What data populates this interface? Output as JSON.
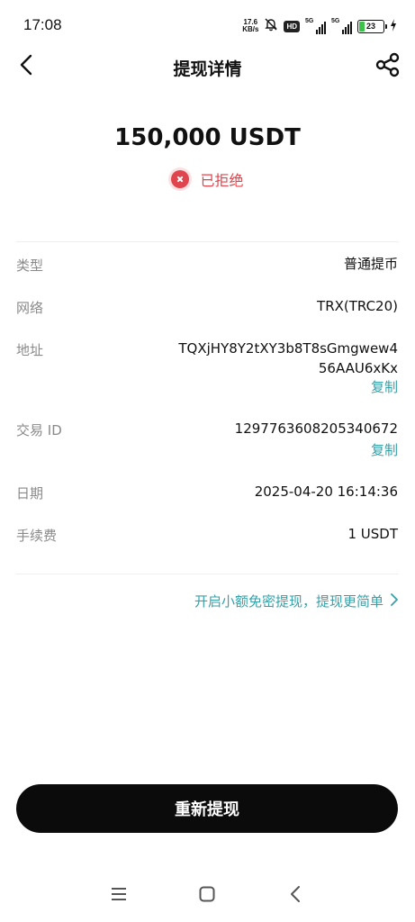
{
  "status_bar": {
    "time": "17:08",
    "net_speed_value": "17.6",
    "net_speed_unit": "KB/s",
    "hd_label": "HD",
    "signal1_label": "5G",
    "signal2_label": "5G",
    "battery_level": "23",
    "battery_fraction": 0.23
  },
  "header": {
    "title": "提现详情",
    "back_icon": "chevron-left-icon",
    "share_icon": "share-icon"
  },
  "summary": {
    "amount": "150,000 USDT",
    "status": "已拒绝",
    "status_color": "#e0454e"
  },
  "details": {
    "type": {
      "label": "类型",
      "value": "普通提币"
    },
    "network": {
      "label": "网络",
      "value": "TRX(TRC20)"
    },
    "address": {
      "label": "地址",
      "line1": "TQXjHY8Y2tXY3b8T8sGmgwew4",
      "line2": "56AAU6xKx",
      "copy_label": "复制"
    },
    "tx_id": {
      "label": "交易 ID",
      "value": "1297763608205340672",
      "copy_label": "复制"
    },
    "date": {
      "label": "日期",
      "value": "2025-04-20 16:14:36"
    },
    "fee": {
      "label": "手续费",
      "value": "1 USDT"
    }
  },
  "promo": {
    "text": "开启小额免密提现，提现更简单",
    "icon": "chevron-right-icon",
    "color": "#35a1a9"
  },
  "cta": {
    "label": "重新提现"
  },
  "system_nav": {
    "menu_icon": "menu-icon",
    "home_icon": "home-icon",
    "back_icon": "back-icon"
  }
}
